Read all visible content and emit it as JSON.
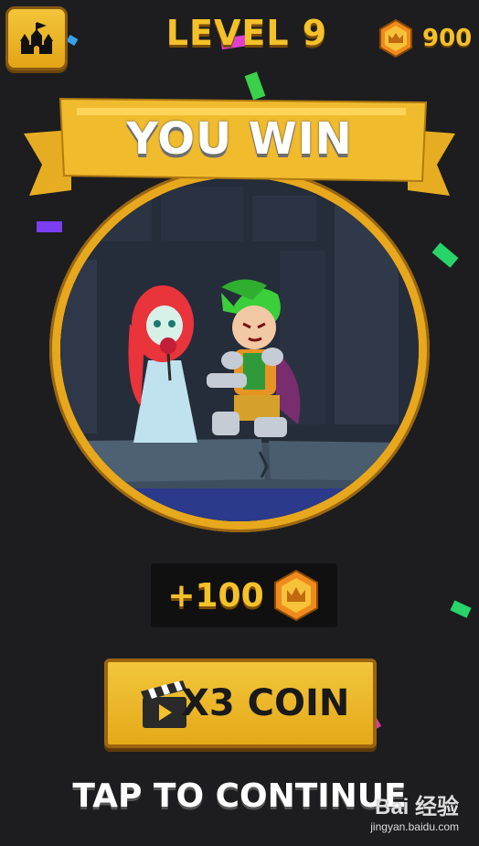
{
  "header": {
    "home_icon": "castle-icon",
    "level_title": "LEVEL 9",
    "coin_icon": "crown-coin-icon",
    "coin_count": "900"
  },
  "result": {
    "banner_title": "YOU WIN",
    "scene_description_icon": "hero-rescue-scene"
  },
  "reward": {
    "amount": "+100",
    "coin_icon": "crown-coin-icon"
  },
  "actions": {
    "x3_icon": "clapperboard-icon",
    "x3_label": "X3 COIN",
    "continue_label": "TAP TO CONTINUE"
  },
  "watermark": {
    "main": "Bai 经验",
    "sub": "jingyan.baidu.com"
  },
  "colors": {
    "gold": "#f5c12a",
    "background": "#1d1d1f",
    "button": "#e5a919"
  }
}
